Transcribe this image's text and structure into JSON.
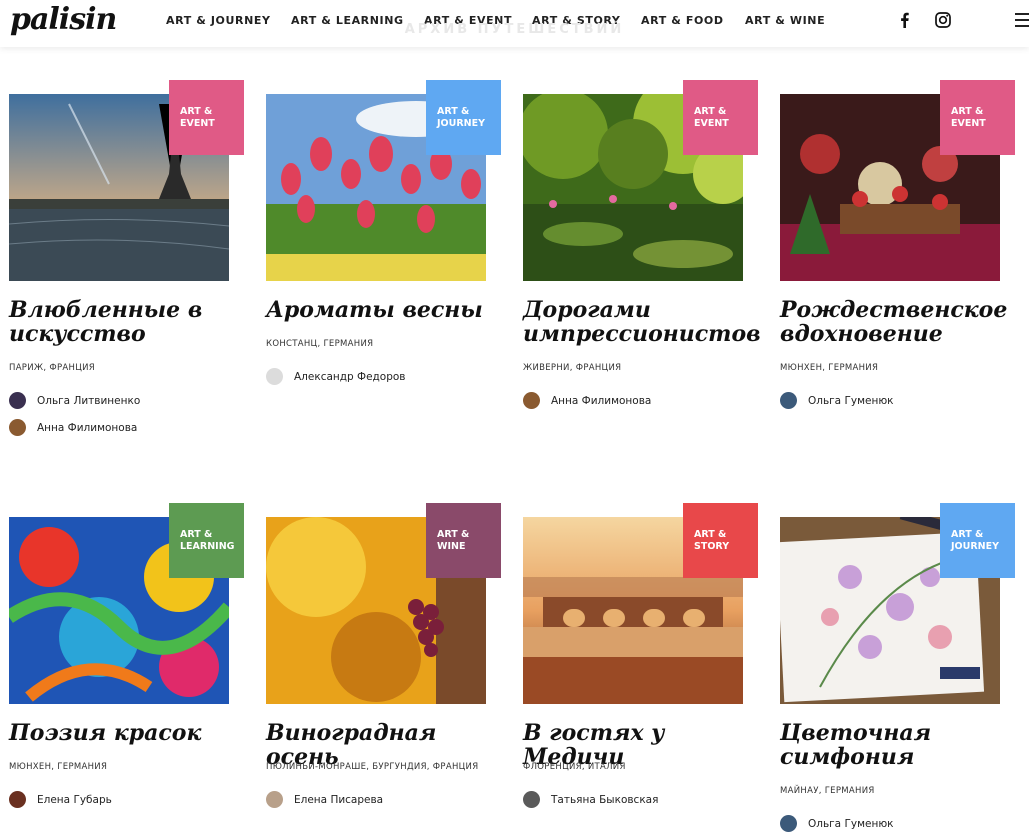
{
  "header": {
    "logo": "palisin",
    "nav": [
      {
        "label": "ART & JOURNEY"
      },
      {
        "label": "ART & LEARNING"
      },
      {
        "label": "ART & EVENT"
      },
      {
        "label": "ART & STORY"
      },
      {
        "label": "ART & FOOD"
      },
      {
        "label": "ART & WINE"
      }
    ],
    "social": [
      "facebook-icon",
      "instagram-icon"
    ],
    "menu_icon": "hamburger-menu-icon"
  },
  "archive_title": "АРХИВ ПУТЕШЕСТВИЙ",
  "colors": {
    "event": "#e05a86",
    "journey": "#5fa8f2",
    "learning": "#5d9b52",
    "wine": "#8a4a6a",
    "story": "#e8484a"
  },
  "cards": [
    {
      "badge": "ART & EVENT",
      "title": "Влюбленные в искусство",
      "location": "ПАРИЖ, ФРАНЦИЯ",
      "authors": [
        "Ольга Литвиненко",
        "Анна Филимонова"
      ]
    },
    {
      "badge": "ART & JOURNEY",
      "title": "Ароматы весны",
      "location": "КОНСТАНЦ, ГЕРМАНИЯ",
      "authors": [
        "Александр Федоров"
      ]
    },
    {
      "badge": "ART & EVENT",
      "title": "Дорогами импрессионистов",
      "location": "ЖИВЕРНИ, ФРАНЦИЯ",
      "authors": [
        "Анна Филимонова"
      ]
    },
    {
      "badge": "ART & EVENT",
      "title": "Рождественское вдохновение",
      "location": "МЮНХЕН, ГЕРМАНИЯ",
      "authors": [
        "Ольга Гуменюк"
      ]
    },
    {
      "badge": "ART & LEARNING",
      "title": "Поэзия красок",
      "location": "МЮНХЕН, ГЕРМАНИЯ",
      "authors": [
        "Елена Губарь"
      ]
    },
    {
      "badge": "ART & WINE",
      "title": "Виноградная осень",
      "location": "ПЮЛИНЬИ-МОНРАШЕ, БУРГУНДИЯ, ФРАНЦИЯ",
      "authors": [
        "Елена Писарева"
      ]
    },
    {
      "badge": "ART & STORY",
      "title": "В гостях у Медичи",
      "location": "ФЛОРЕНЦИЯ, ИТАЛИЯ",
      "authors": [
        "Татьяна Быковская"
      ]
    },
    {
      "badge": "ART & JOURNEY",
      "title": "Цветочная симфония",
      "location": "МАЙНАУ, ГЕРМАНИЯ",
      "authors": [
        "Ольга Гуменюк"
      ]
    }
  ]
}
